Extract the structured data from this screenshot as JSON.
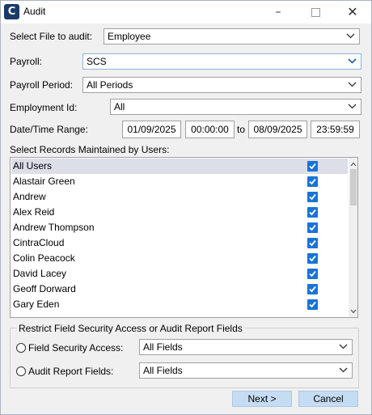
{
  "window": {
    "title": "Audit",
    "app_icon_letter": "C"
  },
  "form": {
    "file_label": "Select File to audit:",
    "file_value": "Employee",
    "payroll_label": "Payroll:",
    "payroll_value": "SCS",
    "period_label": "Payroll Period:",
    "period_value": "All Periods",
    "employment_label": "Employment Id:",
    "employment_value": "All",
    "range_label": "Date/Time Range:",
    "start_date": "01/09/2025",
    "start_time": "00:00:00",
    "to_label": "to",
    "end_date": "08/09/2025",
    "end_time": "23:59:59",
    "users_label": "Select Records Maintained by Users:"
  },
  "users": [
    {
      "name": "All Users",
      "checked": true,
      "selected": true
    },
    {
      "name": "Alastair Green",
      "checked": true
    },
    {
      "name": "Andrew",
      "checked": true
    },
    {
      "name": "Alex Reid",
      "checked": true
    },
    {
      "name": "Andrew Thompson",
      "checked": true
    },
    {
      "name": "CintraCloud",
      "checked": true
    },
    {
      "name": "Colin Peacock",
      "checked": true
    },
    {
      "name": "David Lacey",
      "checked": true
    },
    {
      "name": "Geoff Dorward",
      "checked": true
    },
    {
      "name": "Gary Eden",
      "checked": true
    }
  ],
  "restrict": {
    "group_title": "Restrict Field Security Access or Audit Report Fields",
    "field_security_label": "Field Security Access:",
    "field_security_value": "All Fields",
    "audit_report_label": "Audit Report Fields:",
    "audit_report_value": "All Fields"
  },
  "buttons": {
    "next": "Next >",
    "cancel": "Cancel"
  },
  "colors": {
    "checkbox": "#1a73d6",
    "button": "#c5dcf3",
    "selected_row": "#dcdee8",
    "chevron_focus": "#1f5ea8"
  }
}
